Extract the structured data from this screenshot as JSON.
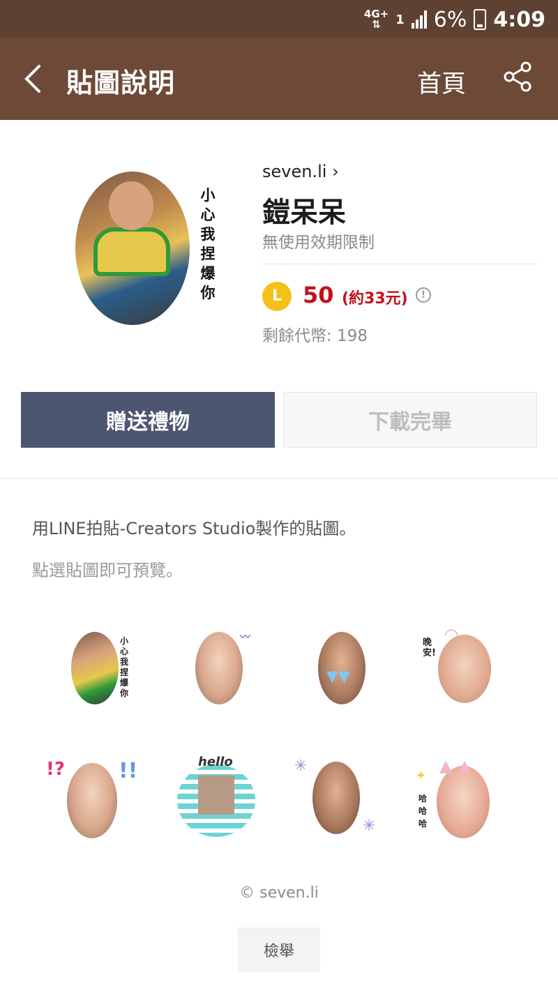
{
  "status_bar": {
    "network": "4G+",
    "sim": "1",
    "battery": "6%",
    "time": "4:09"
  },
  "app_bar": {
    "title": "貼圖說明",
    "home_label": "首頁",
    "back_icon": "chevron-left-icon",
    "share_icon": "share-icon"
  },
  "package": {
    "hero_caption": "小心我捏爆你",
    "author": "seven.li",
    "name": "鎧呆呆",
    "validity": "無使用效期限制",
    "coin_symbol": "L",
    "price": "50",
    "price_approx": "(約33元)",
    "info_symbol": "!",
    "balance": "剩餘代幣: 198"
  },
  "actions": {
    "gift_label": "贈送禮物",
    "download_label": "下載完畢"
  },
  "description": "用LINE拍貼-Creators Studio製作的貼圖。",
  "preview_hint": "點選貼圖即可預覽。",
  "stickers": [
    {
      "name": "sticker-1",
      "caption": "小心我捏爆你"
    },
    {
      "name": "sticker-2",
      "caption": ""
    },
    {
      "name": "sticker-3",
      "caption": ""
    },
    {
      "name": "sticker-4",
      "caption": "晚安!"
    },
    {
      "name": "sticker-5",
      "caption": "!?"
    },
    {
      "name": "sticker-6",
      "caption": "hello"
    },
    {
      "name": "sticker-7",
      "caption": ""
    },
    {
      "name": "sticker-8",
      "caption": "哈 哈 哈"
    }
  ],
  "footer": {
    "copyright": "© seven.li",
    "report_label": "檢舉"
  },
  "colors": {
    "status_bar": "#5e4130",
    "app_bar": "#6d4a37",
    "gift_button": "#4c5670",
    "price_red": "#c1121b",
    "coin_yellow": "#f3c21a"
  }
}
